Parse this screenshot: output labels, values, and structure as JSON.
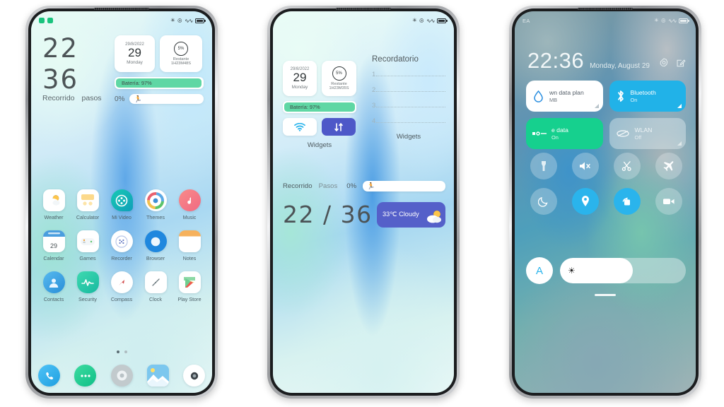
{
  "phone1": {
    "status_bar": {
      "notification_icons": [
        "whatsapp-icon",
        "message-icon"
      ],
      "right_icons": [
        "bluetooth-icon",
        "dnd-icon",
        "signal-icon",
        "battery-icon"
      ]
    },
    "steps_widget": {
      "value_top": "22",
      "value_bottom": "36",
      "label_left": "Recorrido",
      "label_right": "pasos"
    },
    "date_card": {
      "date": "29/8/2022",
      "day_number": "29",
      "weekday": "Monday"
    },
    "battery_card": {
      "percent": "5%",
      "label": "Restante",
      "remaining": "1H23M48S"
    },
    "battery_bar": {
      "text": "Batería: 97%",
      "fill_color": "#5fd7a4"
    },
    "steps_bar": {
      "percent": "0%",
      "icon": "running-icon"
    },
    "apps": [
      [
        {
          "label": "Weather",
          "icon": "weather-icon"
        },
        {
          "label": "Calculator",
          "icon": "calculator-icon"
        },
        {
          "label": "Mi Video",
          "icon": "mi-video-icon"
        },
        {
          "label": "Themes",
          "icon": "themes-icon"
        },
        {
          "label": "Music",
          "icon": "music-icon"
        }
      ],
      [
        {
          "label": "Calendar",
          "icon": "calendar-icon",
          "badge": "29"
        },
        {
          "label": "Games",
          "icon": "games-icon"
        },
        {
          "label": "Recorder",
          "icon": "recorder-icon"
        },
        {
          "label": "Browser",
          "icon": "browser-icon"
        },
        {
          "label": "Notes",
          "icon": "notes-icon"
        }
      ],
      [
        {
          "label": "Contacts",
          "icon": "contacts-icon"
        },
        {
          "label": "Security",
          "icon": "security-icon"
        },
        {
          "label": "Compass",
          "icon": "compass-icon"
        },
        {
          "label": "Clock",
          "icon": "clock-icon"
        },
        {
          "label": "Play Store",
          "icon": "play-store-icon"
        }
      ]
    ],
    "dock": [
      {
        "label": "Phone",
        "icon": "phone-icon"
      },
      {
        "label": "Messages",
        "icon": "messages-icon"
      },
      {
        "label": "Settings",
        "icon": "settings-icon"
      },
      {
        "label": "Gallery",
        "icon": "gallery-icon"
      },
      {
        "label": "Camera",
        "icon": "camera-icon"
      }
    ],
    "page_dots": {
      "count": 2,
      "active": 0
    }
  },
  "phone2": {
    "date_card": {
      "date": "29/8/2022",
      "day_number": "29",
      "weekday": "Monday"
    },
    "battery_card": {
      "percent": "5%",
      "label": "Restante",
      "remaining": "1H23M35S"
    },
    "battery_bar": {
      "text": "Batería: 97%"
    },
    "tiles": [
      {
        "name": "wifi-tile",
        "icon": "wifi-icon"
      },
      {
        "name": "data-transfer-tile",
        "icon": "data-transfer-icon"
      }
    ],
    "widgets_label_left": "Widgets",
    "widgets_label_right": "Widgets",
    "reminder": {
      "title": "Recordatorio",
      "lines": [
        "1",
        "2",
        "3",
        "4"
      ]
    },
    "steps_row": {
      "label1": "Recorrido",
      "label2": "Pasos",
      "percent": "0%",
      "icon": "running-icon"
    },
    "big_numbers": "22 / 36",
    "weather": {
      "text": "33℃ Cloudy",
      "icon": "sun-cloud-icon"
    }
  },
  "phone3": {
    "carrier": "EA",
    "time": "22:36",
    "date": "Monday, August 29",
    "header_icons": [
      {
        "name": "settings-gear-icon"
      },
      {
        "name": "edit-icon"
      }
    ],
    "quick_tiles": [
      {
        "name": "data-plan-tile",
        "title": "wn data plan",
        "sub": "MB",
        "icon": "data-drop-icon",
        "state": "off"
      },
      {
        "name": "bluetooth-tile",
        "title": "Bluetooth",
        "sub": "On",
        "icon": "bluetooth-icon",
        "state": "on"
      },
      {
        "name": "mobile-data-tile",
        "title": "e data",
        "sub": "On",
        "icon": "mobile-data-icon",
        "state": "on"
      },
      {
        "name": "wlan-tile",
        "title": "WLAN",
        "sub": "Off",
        "icon": "wlan-icon",
        "state": "off"
      }
    ],
    "toggles": [
      {
        "name": "flashlight-toggle",
        "icon": "flashlight-icon",
        "state": "off"
      },
      {
        "name": "mute-toggle",
        "icon": "mute-icon",
        "state": "off"
      },
      {
        "name": "screenshot-toggle",
        "icon": "scissors-icon",
        "state": "off"
      },
      {
        "name": "airplane-mode-toggle",
        "icon": "airplane-icon",
        "state": "off"
      },
      {
        "name": "dark-mode-toggle",
        "icon": "moon-icon",
        "state": "off"
      },
      {
        "name": "location-toggle",
        "icon": "location-pin-icon",
        "state": "on"
      },
      {
        "name": "auto-rotate-toggle",
        "icon": "rotate-icon",
        "state": "on"
      },
      {
        "name": "screen-record-toggle",
        "icon": "video-camera-icon",
        "state": "off"
      }
    ],
    "brightness": {
      "auto_label": "A",
      "icon": "brightness-sun-icon",
      "value_percent": 58
    },
    "drag_handle": "drag-handle"
  },
  "colors": {
    "accent_blue": "#2ab4ec",
    "green": "#16d08e",
    "battery_green": "#5fd7a4",
    "purple": "#5560c9"
  }
}
